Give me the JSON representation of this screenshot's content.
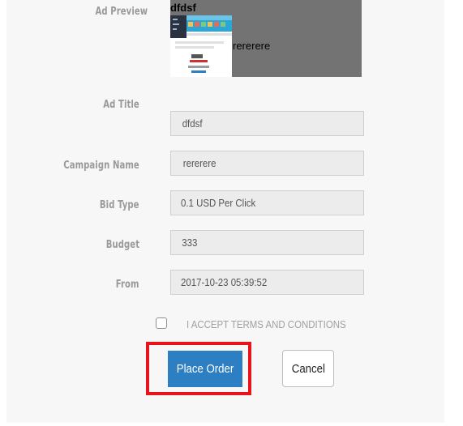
{
  "form": {
    "ad_preview_label": "Ad Preview",
    "preview": {
      "title": "dfdsf",
      "body": "rererere"
    },
    "fields": [
      {
        "label": "Ad Title",
        "value": "dfdsf"
      },
      {
        "label": "Campaign Name",
        "value": "rererere"
      },
      {
        "label": "Bid Type",
        "value": "0.1 USD Per Click"
      },
      {
        "label": "Budget",
        "value": "333"
      },
      {
        "label": "From",
        "value": "2017-10-23 05:39:52"
      }
    ],
    "terms_label": "I ACCEPT TERMS AND CONDITIONS",
    "terms_checked": false,
    "place_order_label": "Place Order",
    "cancel_label": "Cancel"
  },
  "colors": {
    "primary": "#2d7fc4",
    "highlight": "#e8141c",
    "preview_bg": "#737373"
  }
}
